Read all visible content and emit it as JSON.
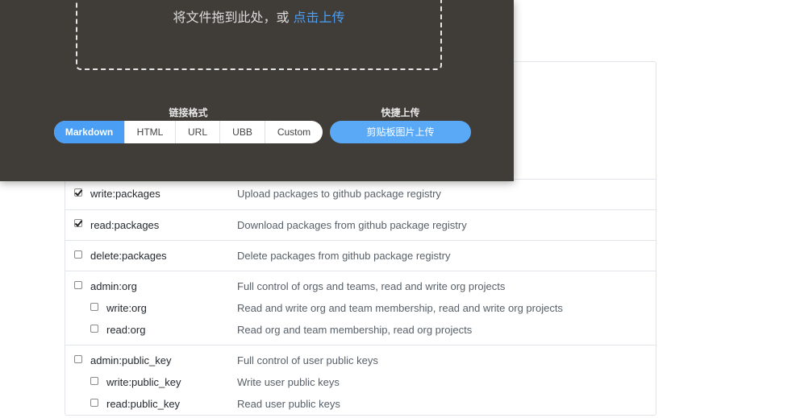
{
  "uploader": {
    "drop_text": "将文件拖到此处，或",
    "drop_link": "点击上传",
    "format_label": "链接格式",
    "formats": [
      "Markdown",
      "HTML",
      "URL",
      "UBB",
      "Custom"
    ],
    "active_format": "Markdown",
    "quick_label": "快捷上传",
    "paste_button": "剪贴板图片上传"
  },
  "scopes": [
    {
      "items": [
        {
          "name": "write:packages",
          "desc": "Upload packages to github package registry",
          "checked": true
        }
      ]
    },
    {
      "items": [
        {
          "name": "read:packages",
          "desc": "Download packages from github package registry",
          "checked": true
        }
      ]
    },
    {
      "items": [
        {
          "name": "delete:packages",
          "desc": "Delete packages from github package registry",
          "checked": false
        }
      ]
    },
    {
      "items": [
        {
          "name": "admin:org",
          "desc": "Full control of orgs and teams, read and write org projects",
          "checked": false
        },
        {
          "name": "write:org",
          "desc": "Read and write org and team membership, read and write org projects",
          "checked": false
        },
        {
          "name": "read:org",
          "desc": "Read org and team membership, read org projects",
          "checked": false
        }
      ]
    },
    {
      "items": [
        {
          "name": "admin:public_key",
          "desc": "Full control of user public keys",
          "checked": false
        },
        {
          "name": "write:public_key",
          "desc": "Write user public keys",
          "checked": false
        },
        {
          "name": "read:public_key",
          "desc": "Read user public keys",
          "checked": false
        }
      ]
    }
  ],
  "colors": {
    "accent": "#4a9ff5",
    "overlay_bg": "#403c38"
  }
}
